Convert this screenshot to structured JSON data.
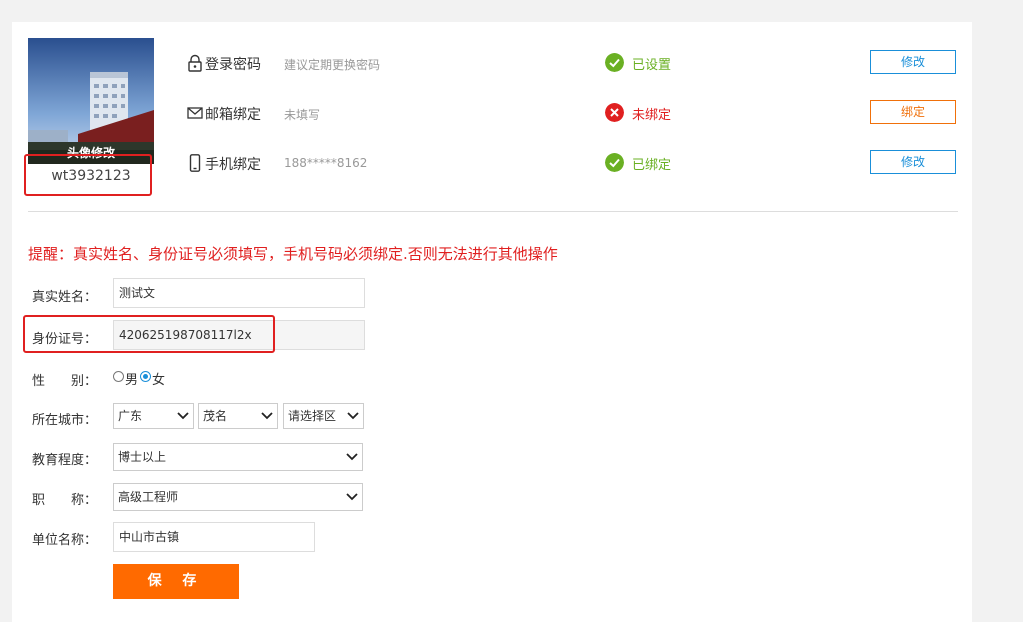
{
  "colors": {
    "accent_blue": "#1a8fd9",
    "warn_orange": "#f0700a",
    "success_green": "#6ab023",
    "error_red": "#e02020",
    "save_orange": "#ff6a00"
  },
  "profile": {
    "avatar_caption": "头像修改",
    "username": "wt3932123"
  },
  "security": [
    {
      "icon": "lock-icon",
      "label": "登录密码",
      "hint": "建议定期更换密码",
      "status": "已设置",
      "status_type": "ok",
      "button": "修改"
    },
    {
      "icon": "envelope-icon",
      "label": "邮箱绑定",
      "hint": "未填写",
      "status": "未绑定",
      "status_type": "error",
      "button": "绑定"
    },
    {
      "icon": "phone-icon",
      "label": "手机绑定",
      "hint": "188*****8162",
      "status": "已绑定",
      "status_type": "ok",
      "button": "修改"
    }
  ],
  "reminder": "提醒：真实姓名、身份证号必须填写，手机号码必须绑定.否则无法进行其他操作",
  "form": {
    "name_label": "真实姓名：",
    "name_value": "测试文",
    "id_label": "身份证号：",
    "id_value": "420625198708117l2x",
    "gender_label": "性　　别：",
    "gender_options": [
      "男",
      "女"
    ],
    "gender_selected": "女",
    "city_label": "所在城市：",
    "province": "广东",
    "city": "茂名",
    "district": "请选择区",
    "edu_label": "教育程度：",
    "edu_value": "博士以上",
    "title_label": "职　　称：",
    "title_value": "高级工程师",
    "unit_label": "单位名称：",
    "unit_value": "中山市古镇",
    "save": "保 存"
  }
}
